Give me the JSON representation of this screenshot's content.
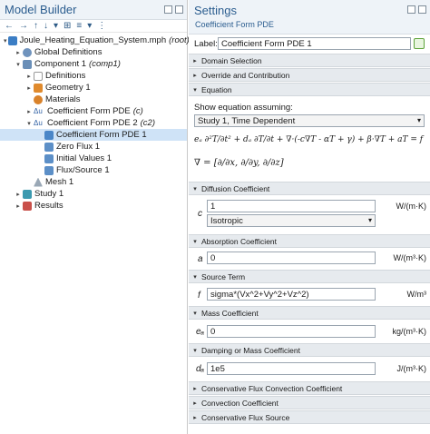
{
  "model_builder": {
    "title": "Model Builder",
    "toolbar": [
      "←",
      "→",
      "↑",
      "↓",
      "▾",
      "⊞",
      "≡",
      "▾",
      "⋮"
    ],
    "tree": [
      {
        "label": "Joule_Heating_Equation_System.mph",
        "tag": "(root)",
        "icon": "file-icon",
        "twisty": "▾"
      },
      {
        "label": "Global Definitions",
        "tag": "",
        "icon": "globe-icon",
        "twisty": "▸"
      },
      {
        "label": "Component 1",
        "tag": "(comp1)",
        "icon": "component-icon",
        "twisty": "▾"
      },
      {
        "label": "Definitions",
        "tag": "",
        "icon": "definitions-icon",
        "twisty": "▸"
      },
      {
        "label": "Geometry 1",
        "tag": "",
        "icon": "geometry-icon",
        "twisty": "▸"
      },
      {
        "label": "Materials",
        "tag": "",
        "icon": "materials-icon",
        "twisty": ""
      },
      {
        "label": "Coefficient Form PDE",
        "tag": "(c)",
        "icon": "pde-icon",
        "twisty": "▸"
      },
      {
        "label": "Coefficient Form PDE 2",
        "tag": "(c2)",
        "icon": "pde-icon",
        "twisty": "▾"
      },
      {
        "label": "Coefficient Form PDE 1",
        "tag": "",
        "icon": "pde-node-icon",
        "twisty": ""
      },
      {
        "label": "Zero Flux 1",
        "tag": "",
        "icon": "boundary-icon",
        "twisty": ""
      },
      {
        "label": "Initial Values 1",
        "tag": "",
        "icon": "initial-values-icon",
        "twisty": ""
      },
      {
        "label": "Flux/Source 1",
        "tag": "",
        "icon": "flux-icon",
        "twisty": ""
      },
      {
        "label": "Mesh 1",
        "tag": "",
        "icon": "mesh-icon",
        "twisty": ""
      },
      {
        "label": "Study 1",
        "tag": "",
        "icon": "study-icon",
        "twisty": "▸"
      },
      {
        "label": "Results",
        "tag": "",
        "icon": "results-icon",
        "twisty": "▸"
      }
    ]
  },
  "settings": {
    "title": "Settings",
    "subtitle": "Coefficient Form PDE",
    "label_caption": "Label:",
    "label_value": "Coefficient Form PDE 1",
    "sections": {
      "domain_selection": "Domain Selection",
      "override": "Override and Contribution",
      "equation": "Equation",
      "diffusion": "Diffusion Coefficient",
      "absorption": "Absorption Coefficient",
      "source": "Source Term",
      "mass": "Mass Coefficient",
      "damping": "Damping or Mass Coefficient",
      "cons_conv": "Conservative Flux Convection Coefficient",
      "convection": "Convection Coefficient",
      "cons_source": "Conservative Flux Source"
    },
    "show_equation_label": "Show equation assuming:",
    "study_select": "Study 1, Time Dependent",
    "equation_main": "eₐ ∂²T/∂t² + dₐ ∂T/∂t + ∇·(-c∇T - αT + γ) + β·∇T + aT = f",
    "equation_nabla": "∇ = [∂/∂x, ∂/∂y, ∂/∂z]",
    "diffusion_symbol": "c",
    "diffusion_value": "1",
    "diffusion_unit": "W/(m·K)",
    "diffusion_type": "Isotropic",
    "absorption_symbol": "a",
    "absorption_value": "0",
    "absorption_unit": "W/(m³·K)",
    "source_symbol": "f",
    "source_value": "sigma*(Vx^2+Vy^2+Vz^2)",
    "source_unit": "W/m³",
    "mass_symbol": "eₐ",
    "mass_value": "0",
    "mass_unit": "kg/(m³·K)",
    "damping_symbol": "dₐ",
    "damping_value": "1e5",
    "damping_unit": "J/(m³·K)"
  }
}
